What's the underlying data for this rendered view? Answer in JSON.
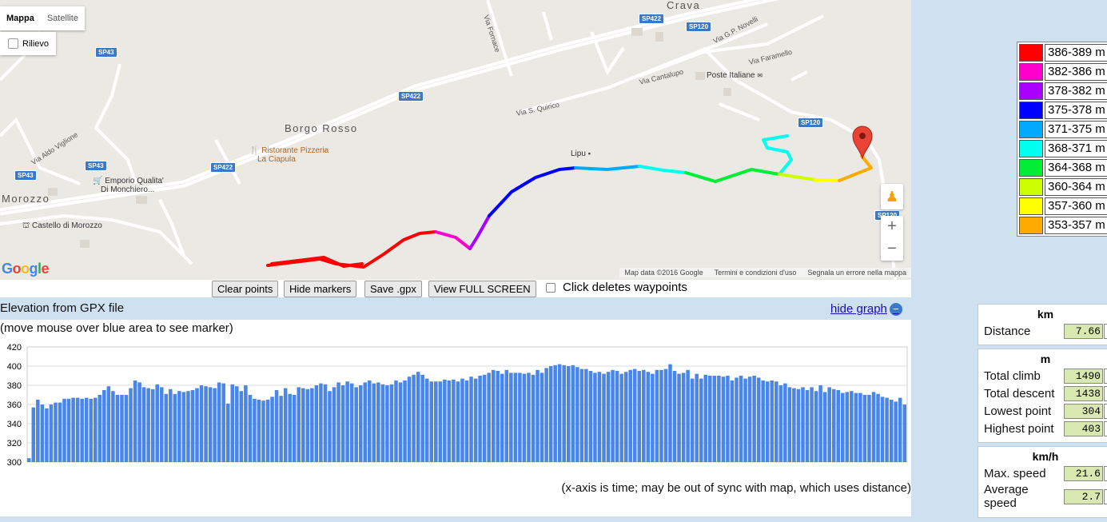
{
  "map": {
    "type_tabs": [
      {
        "label": "Mappa",
        "active": true
      },
      {
        "label": "Satellite",
        "active": false
      }
    ],
    "relief_label": "Rilievo",
    "towns": [
      "Crava",
      "Borgo Rosso",
      "Morozzo"
    ],
    "road_shields": [
      "SP422",
      "SP120",
      "SP43",
      "SP43",
      "SP43",
      "SP422",
      "SP422",
      "SP120",
      "SP120"
    ],
    "places": [
      "Poste Italiane",
      "Lipu",
      "Ristorante Pizzeria",
      "La Ciapula",
      "Emporio Qualita'",
      "Di Monchiero...",
      "Castello di Morozzo"
    ],
    "streets": [
      "Via Fornace",
      "Via G.P. Novelli",
      "Via Faramello",
      "Via Cantalupo",
      "Via S. Quirico",
      "Via Aldo Viglione"
    ],
    "logo": "Google",
    "attribution": [
      "Map data ©2016 Google",
      "Termini e condizioni d'uso",
      "Segnala un errore nella mappa"
    ],
    "zoom_in": "+",
    "zoom_out": "−"
  },
  "toolbar": {
    "clear_points": "Clear points",
    "hide_markers": "Hide markers",
    "save_gpx": "Save .gpx",
    "view_fullscreen": "View FULL SCREEN",
    "click_deletes": "Click deletes waypoints"
  },
  "elevation": {
    "header": "Elevation from GPX file",
    "hide_graph": "hide graph",
    "hint": "(move mouse over blue area to see marker)",
    "x_note": "(x-axis is time; may be out of sync with map, which uses distance)"
  },
  "legend": [
    {
      "color": "#ff0000",
      "label": "386-389 m"
    },
    {
      "color": "#ff00cc",
      "label": "382-386 m"
    },
    {
      "color": "#aa00ff",
      "label": "378-382 m"
    },
    {
      "color": "#0000ff",
      "label": "375-378 m"
    },
    {
      "color": "#00aaff",
      "label": "371-375 m"
    },
    {
      "color": "#00ffee",
      "label": "368-371 m"
    },
    {
      "color": "#00ee33",
      "label": "364-368 m"
    },
    {
      "color": "#ccff00",
      "label": "360-364 m"
    },
    {
      "color": "#ffff00",
      "label": "357-360 m"
    },
    {
      "color": "#ffaa00",
      "label": "353-357 m"
    }
  ],
  "stats": {
    "distance": {
      "unit": "km",
      "rows": [
        {
          "label": "Distance",
          "value": "7.66"
        }
      ]
    },
    "elevation": {
      "unit": "m",
      "rows": [
        {
          "label": "Total climb",
          "value": "1490"
        },
        {
          "label": "Total descent",
          "value": "1438"
        },
        {
          "label": "Lowest point",
          "value": "304"
        },
        {
          "label": "Highest point",
          "value": "403"
        }
      ]
    },
    "speed": {
      "unit": "km/h",
      "rows": [
        {
          "label": "Max. speed",
          "value": "21.6"
        },
        {
          "label": "Average speed",
          "value": "2.7"
        }
      ]
    }
  },
  "chart_data": {
    "type": "bar",
    "title": "",
    "xlabel": "",
    "ylabel": "",
    "ylim": [
      300,
      420
    ],
    "yticks": [
      300,
      320,
      340,
      360,
      380,
      400,
      420
    ],
    "bar_color": "#4a86e8",
    "grid": true,
    "values": [
      304,
      357,
      365,
      360,
      356,
      360,
      362,
      362,
      366,
      366,
      367,
      367,
      366,
      367,
      366,
      367,
      370,
      375,
      379,
      374,
      370,
      370,
      370,
      377,
      385,
      383,
      378,
      377,
      376,
      381,
      378,
      371,
      376,
      371,
      374,
      373,
      374,
      375,
      377,
      380,
      379,
      378,
      377,
      383,
      382,
      361,
      381,
      379,
      374,
      380,
      370,
      366,
      365,
      364,
      365,
      368,
      375,
      369,
      377,
      371,
      370,
      378,
      377,
      376,
      377,
      380,
      382,
      381,
      374,
      378,
      383,
      380,
      384,
      382,
      378,
      380,
      383,
      385,
      382,
      383,
      381,
      380,
      381,
      385,
      383,
      385,
      389,
      391,
      394,
      391,
      387,
      384,
      384,
      384,
      386,
      385,
      386,
      384,
      387,
      385,
      389,
      387,
      390,
      391,
      393,
      396,
      395,
      392,
      396,
      393,
      393,
      393,
      392,
      393,
      391,
      396,
      393,
      398,
      400,
      401,
      402,
      401,
      400,
      401,
      399,
      397,
      397,
      395,
      393,
      394,
      392,
      394,
      396,
      395,
      392,
      394,
      396,
      397,
      395,
      396,
      394,
      392,
      396,
      396,
      397,
      402,
      395,
      392,
      393,
      396,
      387,
      392,
      387,
      391,
      390,
      390,
      390,
      389,
      390,
      385,
      388,
      390,
      387,
      389,
      390,
      388,
      385,
      384,
      385,
      384,
      380,
      382,
      378,
      377,
      376,
      378,
      375,
      378,
      374,
      380,
      373,
      378,
      376,
      375,
      372,
      373,
      374,
      372,
      372,
      370,
      370,
      373,
      371,
      368,
      367,
      365,
      363,
      367,
      360
    ]
  }
}
